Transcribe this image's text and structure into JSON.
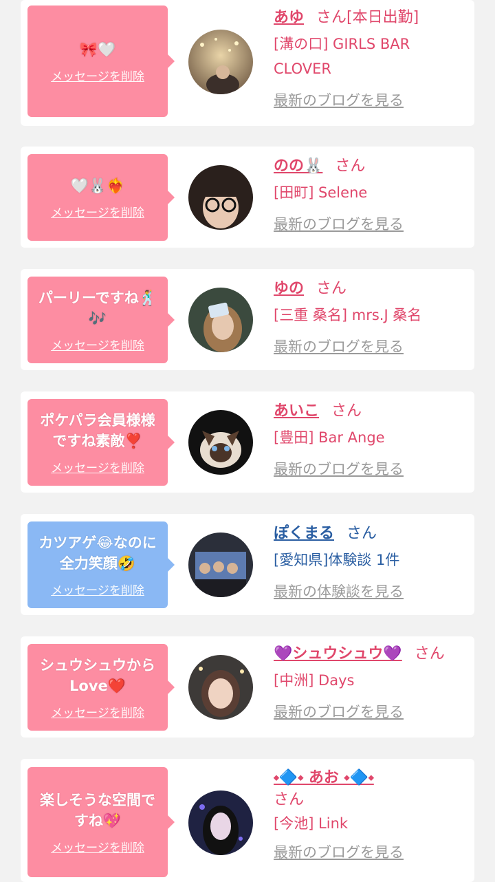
{
  "colors": {
    "pink_bubble": "#fd8da2",
    "blue_bubble": "#8ab8f4",
    "pink_text": "#e0476b",
    "blue_text": "#2a5ea2",
    "muted": "#9a9a9a"
  },
  "items": [
    {
      "message": "🎀🤍",
      "delete_label": "メッセージを削除",
      "name": "あゆ",
      "san": "さん[本日出勤]",
      "shop": "[溝の口] GIRLS BAR CLOVER",
      "more": "最新のブログを見る"
    },
    {
      "message": "🤍🐰❤️‍🔥",
      "delete_label": "メッセージを削除",
      "name": "のの🐰",
      "san": "さん",
      "shop": "[田町] Selene",
      "more": "最新のブログを見る"
    },
    {
      "message": "パーリーですね🕺🎶",
      "delete_label": "メッセージを削除",
      "name": "ゆの",
      "san": "さん",
      "shop": "[三重 桑名] mrs.J 桑名",
      "more": "最新のブログを見る"
    },
    {
      "message": "ポケパラ会員様様ですね素敵❣️",
      "delete_label": "メッセージを削除",
      "name": "あいこ",
      "san": "さん",
      "shop": "[豊田] Bar Ange",
      "more": "最新のブログを見る"
    },
    {
      "message": "カツアゲ😂なのに全力笑顔🤣",
      "delete_label": "メッセージを削除",
      "name": "ぽくまる",
      "san": "さん",
      "shop": "[愛知県]体験談 1件",
      "more": "最新の体験談を見る"
    },
    {
      "message": "シュウシュウからLove❤️",
      "delete_label": "メッセージを削除",
      "name": "💜シュウシュウ💜",
      "san": "さん",
      "shop": "[中洲] Days",
      "more": "最新のブログを見る"
    },
    {
      "message": "楽しそうな空間ですね💖",
      "delete_label": "メッセージを削除",
      "name": "⬩🔷⬩ あお ⬩🔷⬩",
      "san": "さん",
      "shop": "[今池] Link",
      "more": "最新のブログを見る"
    }
  ]
}
